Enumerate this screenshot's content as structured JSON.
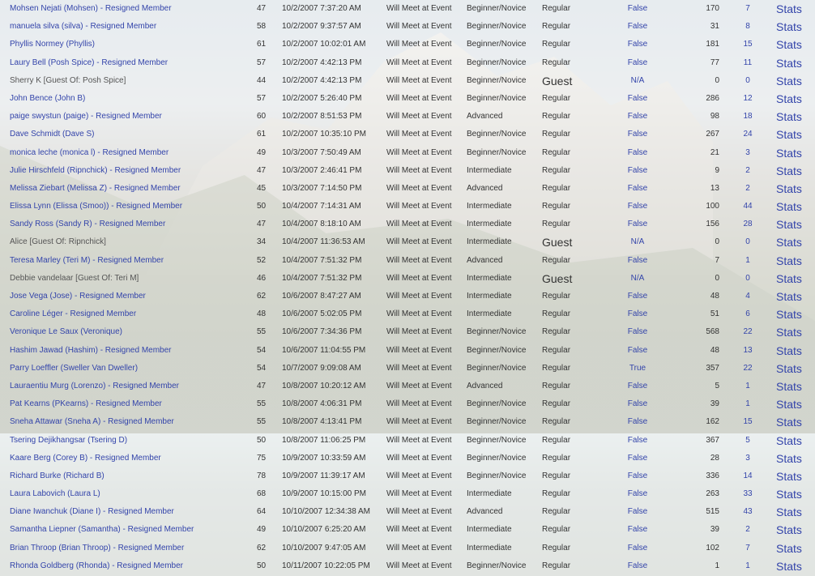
{
  "rows": [
    {
      "name": "Mohsen Nejati (Mohsen) - Resigned Member",
      "age": "47",
      "date": "10/2/2007 7:37:20 AM",
      "meet": "Will Meet at Event",
      "level": "Beginner/Novice",
      "type": "Regular",
      "flag": "False",
      "n1": "170",
      "n2": "7",
      "stats": "Stats",
      "guest": false
    },
    {
      "name": "manuela silva (silva) - Resigned Member",
      "age": "58",
      "date": "10/2/2007 9:37:57 AM",
      "meet": "Will Meet at Event",
      "level": "Beginner/Novice",
      "type": "Regular",
      "flag": "False",
      "n1": "31",
      "n2": "8",
      "stats": "Stats",
      "guest": false
    },
    {
      "name": "Phyllis Normey (Phyllis)",
      "age": "61",
      "date": "10/2/2007 10:02:01 AM",
      "meet": "Will Meet at Event",
      "level": "Beginner/Novice",
      "type": "Regular",
      "flag": "False",
      "n1": "181",
      "n2": "15",
      "stats": "Stats",
      "guest": false
    },
    {
      "name": "Laury Bell (Posh Spice) - Resigned Member",
      "age": "57",
      "date": "10/2/2007 4:42:13 PM",
      "meet": "Will Meet at Event",
      "level": "Beginner/Novice",
      "type": "Regular",
      "flag": "False",
      "n1": "77",
      "n2": "11",
      "stats": "Stats",
      "guest": false
    },
    {
      "name": "Sherry K [Guest Of: Posh Spice]",
      "age": "44",
      "date": "10/2/2007 4:42:13 PM",
      "meet": "Will Meet at Event",
      "level": "Beginner/Novice",
      "type": "Guest",
      "flag": "N/A",
      "n1": "0",
      "n2": "0",
      "stats": "Stats",
      "guest": true
    },
    {
      "name": "John Bence (John B)",
      "age": "57",
      "date": "10/2/2007 5:26:40 PM",
      "meet": "Will Meet at Event",
      "level": "Beginner/Novice",
      "type": "Regular",
      "flag": "False",
      "n1": "286",
      "n2": "12",
      "stats": "Stats",
      "guest": false
    },
    {
      "name": "paige swystun (paige) - Resigned Member",
      "age": "60",
      "date": "10/2/2007 8:51:53 PM",
      "meet": "Will Meet at Event",
      "level": "Advanced",
      "type": "Regular",
      "flag": "False",
      "n1": "98",
      "n2": "18",
      "stats": "Stats",
      "guest": false
    },
    {
      "name": "Dave Schmidt (Dave S)",
      "age": "61",
      "date": "10/2/2007 10:35:10 PM",
      "meet": "Will Meet at Event",
      "level": "Beginner/Novice",
      "type": "Regular",
      "flag": "False",
      "n1": "267",
      "n2": "24",
      "stats": "Stats",
      "guest": false
    },
    {
      "name": "monica leche (monica l) - Resigned Member",
      "age": "49",
      "date": "10/3/2007 7:50:49 AM",
      "meet": "Will Meet at Event",
      "level": "Beginner/Novice",
      "type": "Regular",
      "flag": "False",
      "n1": "21",
      "n2": "3",
      "stats": "Stats",
      "guest": false
    },
    {
      "name": "Julie Hirschfeld (Ripnchick) - Resigned Member",
      "age": "47",
      "date": "10/3/2007 2:46:41 PM",
      "meet": "Will Meet at Event",
      "level": "Intermediate",
      "type": "Regular",
      "flag": "False",
      "n1": "9",
      "n2": "2",
      "stats": "Stats",
      "guest": false
    },
    {
      "name": "Melissa Ziebart (Melissa Z) - Resigned Member",
      "age": "45",
      "date": "10/3/2007 7:14:50 PM",
      "meet": "Will Meet at Event",
      "level": "Advanced",
      "type": "Regular",
      "flag": "False",
      "n1": "13",
      "n2": "2",
      "stats": "Stats",
      "guest": false
    },
    {
      "name": "Elissa Lynn (Elissa (Smoo)) - Resigned Member",
      "age": "50",
      "date": "10/4/2007 7:14:31 AM",
      "meet": "Will Meet at Event",
      "level": "Intermediate",
      "type": "Regular",
      "flag": "False",
      "n1": "100",
      "n2": "44",
      "stats": "Stats",
      "guest": false
    },
    {
      "name": "Sandy Ross (Sandy R) - Resigned Member",
      "age": "47",
      "date": "10/4/2007 8:18:10 AM",
      "meet": "Will Meet at Event",
      "level": "Intermediate",
      "type": "Regular",
      "flag": "False",
      "n1": "156",
      "n2": "28",
      "stats": "Stats",
      "guest": false
    },
    {
      "name": "Alice [Guest Of: Ripnchick]",
      "age": "34",
      "date": "10/4/2007 11:36:53 AM",
      "meet": "Will Meet at Event",
      "level": "Intermediate",
      "type": "Guest",
      "flag": "N/A",
      "n1": "0",
      "n2": "0",
      "stats": "Stats",
      "guest": true
    },
    {
      "name": "Teresa Marley (Teri M) - Resigned Member",
      "age": "52",
      "date": "10/4/2007 7:51:32 PM",
      "meet": "Will Meet at Event",
      "level": "Advanced",
      "type": "Regular",
      "flag": "False",
      "n1": "7",
      "n2": "1",
      "stats": "Stats",
      "guest": false
    },
    {
      "name": "Debbie vandelaar [Guest Of: Teri M]",
      "age": "46",
      "date": "10/4/2007 7:51:32 PM",
      "meet": "Will Meet at Event",
      "level": "Intermediate",
      "type": "Guest",
      "flag": "N/A",
      "n1": "0",
      "n2": "0",
      "stats": "Stats",
      "guest": true
    },
    {
      "name": "Jose Vega (Jose) - Resigned Member",
      "age": "62",
      "date": "10/6/2007 8:47:27 AM",
      "meet": "Will Meet at Event",
      "level": "Intermediate",
      "type": "Regular",
      "flag": "False",
      "n1": "48",
      "n2": "4",
      "stats": "Stats",
      "guest": false
    },
    {
      "name": "Caroline Léger - Resigned Member",
      "age": "48",
      "date": "10/6/2007 5:02:05 PM",
      "meet": "Will Meet at Event",
      "level": "Intermediate",
      "type": "Regular",
      "flag": "False",
      "n1": "51",
      "n2": "6",
      "stats": "Stats",
      "guest": false
    },
    {
      "name": "Veronique Le Saux (Veronique)",
      "age": "55",
      "date": "10/6/2007 7:34:36 PM",
      "meet": "Will Meet at Event",
      "level": "Beginner/Novice",
      "type": "Regular",
      "flag": "False",
      "n1": "568",
      "n2": "22",
      "stats": "Stats",
      "guest": false
    },
    {
      "name": "Hashim Jawad (Hashim) - Resigned Member",
      "age": "54",
      "date": "10/6/2007 11:04:55 PM",
      "meet": "Will Meet at Event",
      "level": "Beginner/Novice",
      "type": "Regular",
      "flag": "False",
      "n1": "48",
      "n2": "13",
      "stats": "Stats",
      "guest": false
    },
    {
      "name": "Parry Loeffler (Sweller Van Dweller)",
      "age": "54",
      "date": "10/7/2007 9:09:08 AM",
      "meet": "Will Meet at Event",
      "level": "Beginner/Novice",
      "type": "Regular",
      "flag": "True",
      "n1": "357",
      "n2": "22",
      "stats": "Stats",
      "guest": false
    },
    {
      "name": "Lauraentiu Murg (Lorenzo) - Resigned Member",
      "age": "47",
      "date": "10/8/2007 10:20:12 AM",
      "meet": "Will Meet at Event",
      "level": "Advanced",
      "type": "Regular",
      "flag": "False",
      "n1": "5",
      "n2": "1",
      "stats": "Stats",
      "guest": false
    },
    {
      "name": "Pat Kearns (PKearns) - Resigned Member",
      "age": "55",
      "date": "10/8/2007 4:06:31 PM",
      "meet": "Will Meet at Event",
      "level": "Beginner/Novice",
      "type": "Regular",
      "flag": "False",
      "n1": "39",
      "n2": "1",
      "stats": "Stats",
      "guest": false
    },
    {
      "name": "Sneha Attawar (Sneha A) - Resigned Member",
      "age": "55",
      "date": "10/8/2007 4:13:41 PM",
      "meet": "Will Meet at Event",
      "level": "Beginner/Novice",
      "type": "Regular",
      "flag": "False",
      "n1": "162",
      "n2": "15",
      "stats": "Stats",
      "guest": false
    },
    {
      "name": "Tsering Dejikhangsar (Tsering D)",
      "age": "50",
      "date": "10/8/2007 11:06:25 PM",
      "meet": "Will Meet at Event",
      "level": "Beginner/Novice",
      "type": "Regular",
      "flag": "False",
      "n1": "367",
      "n2": "5",
      "stats": "Stats",
      "guest": false
    },
    {
      "name": "Kaare Berg (Corey B) - Resigned Member",
      "age": "75",
      "date": "10/9/2007 10:33:59 AM",
      "meet": "Will Meet at Event",
      "level": "Beginner/Novice",
      "type": "Regular",
      "flag": "False",
      "n1": "28",
      "n2": "3",
      "stats": "Stats",
      "guest": false
    },
    {
      "name": "Richard Burke (Richard B)",
      "age": "78",
      "date": "10/9/2007 11:39:17 AM",
      "meet": "Will Meet at Event",
      "level": "Beginner/Novice",
      "type": "Regular",
      "flag": "False",
      "n1": "336",
      "n2": "14",
      "stats": "Stats",
      "guest": false
    },
    {
      "name": "Laura Labovich (Laura L)",
      "age": "68",
      "date": "10/9/2007 10:15:00 PM",
      "meet": "Will Meet at Event",
      "level": "Intermediate",
      "type": "Regular",
      "flag": "False",
      "n1": "263",
      "n2": "33",
      "stats": "Stats",
      "guest": false
    },
    {
      "name": "Diane Iwanchuk (Diane I) - Resigned Member",
      "age": "64",
      "date": "10/10/2007 12:34:38 AM",
      "meet": "Will Meet at Event",
      "level": "Advanced",
      "type": "Regular",
      "flag": "False",
      "n1": "515",
      "n2": "43",
      "stats": "Stats",
      "guest": false
    },
    {
      "name": "Samantha Liepner (Samantha) - Resigned Member",
      "age": "49",
      "date": "10/10/2007 6:25:20 AM",
      "meet": "Will Meet at Event",
      "level": "Intermediate",
      "type": "Regular",
      "flag": "False",
      "n1": "39",
      "n2": "2",
      "stats": "Stats",
      "guest": false
    },
    {
      "name": "Brian Throop (Brian Throop) - Resigned Member",
      "age": "62",
      "date": "10/10/2007 9:47:05 AM",
      "meet": "Will Meet at Event",
      "level": "Intermediate",
      "type": "Regular",
      "flag": "False",
      "n1": "102",
      "n2": "7",
      "stats": "Stats",
      "guest": false
    },
    {
      "name": "Rhonda Goldberg (Rhonda) - Resigned Member",
      "age": "50",
      "date": "10/11/2007 10:22:05 PM",
      "meet": "Will Meet at Event",
      "level": "Beginner/Novice",
      "type": "Regular",
      "flag": "False",
      "n1": "1",
      "n2": "1",
      "stats": "Stats",
      "guest": false
    }
  ]
}
